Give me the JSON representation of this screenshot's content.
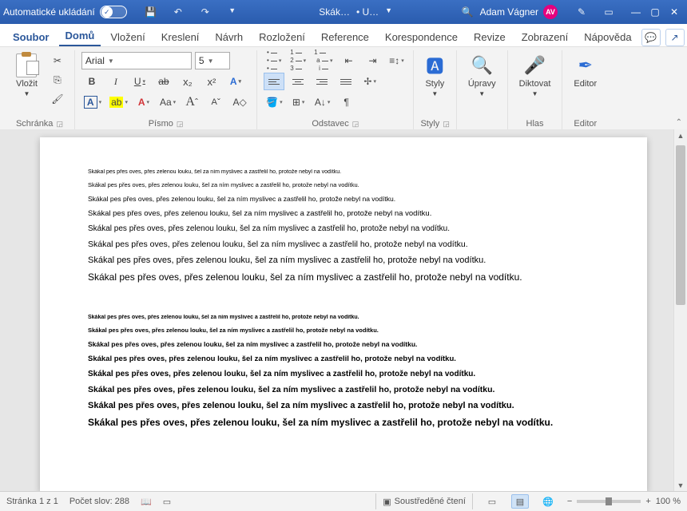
{
  "titlebar": {
    "autosave": "Automatické ukládání",
    "doc1": "Skák…",
    "doc2": "• U…",
    "user": "Adam Vágner",
    "initials": "AV"
  },
  "menu": {
    "file": "Soubor",
    "home": "Domů",
    "insert": "Vložení",
    "draw": "Kreslení",
    "design": "Návrh",
    "layout": "Rozložení",
    "references": "Reference",
    "mailings": "Korespondence",
    "review": "Revize",
    "view": "Zobrazení",
    "help": "Nápověda"
  },
  "ribbon": {
    "paste": "Vložit",
    "clipboard": "Schránka",
    "font_name": "Arial",
    "font_size": "5",
    "font_group": "Písmo",
    "paragraph": "Odstavec",
    "styles_btn": "Styly",
    "styles_group": "Styly",
    "editing": "Úpravy",
    "dictate": "Diktovat",
    "voice": "Hlas",
    "editor": "Editor",
    "editor_group": "Editor"
  },
  "doc": {
    "line": "Skákal pes přes oves, přes zelenou louku, šel za ním myslivec a zastřelil ho, protože nebyl na vodítku."
  },
  "status": {
    "page": "Stránka 1 z 1",
    "words": "Počet slov: 288",
    "focus": "Soustředěné čtení",
    "zoom": "100 %"
  }
}
